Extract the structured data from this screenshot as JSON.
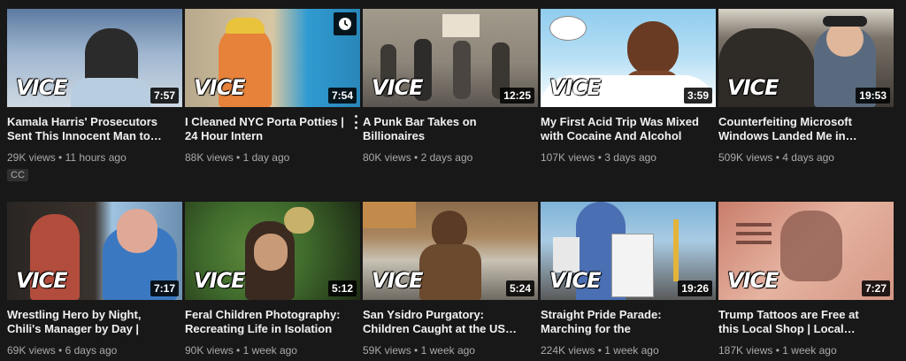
{
  "videos": [
    {
      "title": "Kamala Harris' Prosecutors Sent This Innocent Man to…",
      "views": "29K views",
      "age": "11 hours ago",
      "duration": "7:57",
      "badge": "CC",
      "logo": "VICE",
      "colors": [
        "#5d7aa0",
        "#c9d6e3",
        "#2b2b2b"
      ]
    },
    {
      "title": "I Cleaned NYC Porta Potties | 24 Hour Intern",
      "views": "88K views",
      "age": "1 day ago",
      "duration": "7:54",
      "logo": "VICE",
      "watch_later_icon": "clock-icon",
      "colors": [
        "#e6823a",
        "#2f9bd1",
        "#f0d39a"
      ]
    },
    {
      "title": "A Punk Bar Takes on Billionaires",
      "views": "80K views",
      "age": "2 days ago",
      "duration": "12:25",
      "logo": "VICE",
      "colors": [
        "#8d8579",
        "#c1b9a8",
        "#3d3a36"
      ]
    },
    {
      "title": "My First Acid Trip Was Mixed with Cocaine And Alcohol",
      "views": "107K views",
      "age": "3 days ago",
      "duration": "3:59",
      "logo": "VICE",
      "colors": [
        "#9fd3f0",
        "#ffffff",
        "#6a3b23"
      ]
    },
    {
      "title": "Counterfeiting Microsoft Windows Landed Me in…",
      "views": "509K views",
      "age": "4 days ago",
      "duration": "19:53",
      "logo": "VICE",
      "colors": [
        "#4c4640",
        "#b9b0a4",
        "#2a2a2a"
      ]
    },
    {
      "title": "Wrestling Hero by Night, Chili's Manager by Day | Loc…",
      "views": "69K views",
      "age": "6 days ago",
      "duration": "7:17",
      "logo": "VICE",
      "colors": [
        "#b24c3c",
        "#3a78c2",
        "#1e1e1e"
      ]
    },
    {
      "title": "Feral Children Photography: Recreating Life in Isolation",
      "views": "90K views",
      "age": "1 week ago",
      "duration": "5:12",
      "logo": "VICE",
      "colors": [
        "#3f6a2c",
        "#c8b26b",
        "#1f2c15"
      ]
    },
    {
      "title": "San Ysidro Purgatory: Children Caught at the US…",
      "views": "59K views",
      "age": "1 week ago",
      "duration": "5:24",
      "logo": "VICE",
      "colors": [
        "#c8c2b4",
        "#6c4a2e",
        "#3e3a34"
      ]
    },
    {
      "title": "Straight Pride Parade: Marching for the \"Oppresse…",
      "views": "224K views",
      "age": "1 week ago",
      "duration": "19:26",
      "logo": "VICE",
      "colors": [
        "#7fb3d8",
        "#4a6fb3",
        "#2e2e2e"
      ]
    },
    {
      "title": "Trump Tattoos are Free at this Local Shop | Local…",
      "views": "187K views",
      "age": "1 week ago",
      "duration": "7:27",
      "logo": "VICE",
      "colors": [
        "#c97d6b",
        "#e6b3a1",
        "#4a2c25"
      ]
    }
  ],
  "menu_icon": "more-vert-icon",
  "separator": "•"
}
